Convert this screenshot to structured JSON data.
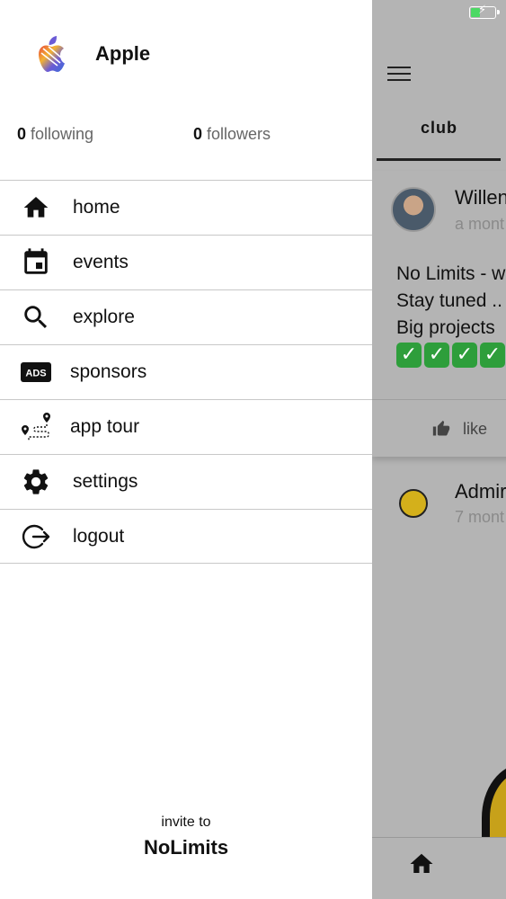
{
  "drawer": {
    "app_name": "Apple",
    "following_count": "0",
    "following_label": "following",
    "followers_count": "0",
    "followers_label": "followers",
    "menu": [
      {
        "label": "home",
        "icon": "home-icon"
      },
      {
        "label": "events",
        "icon": "calendar-icon"
      },
      {
        "label": "explore",
        "icon": "search-icon"
      },
      {
        "label": "sponsors",
        "icon": "ads-icon"
      },
      {
        "label": "app tour",
        "icon": "route-icon"
      },
      {
        "label": "settings",
        "icon": "gear-icon"
      },
      {
        "label": "logout",
        "icon": "logout-icon"
      }
    ],
    "ads_badge": "ADS",
    "invite_label": "invite to",
    "invite_brand": "NoLimits"
  },
  "background": {
    "tab_label": "club",
    "post1": {
      "author": "Willen",
      "time": "a mont",
      "lines": [
        "No Limits - w",
        "Stay tuned ..",
        "Big projects"
      ],
      "check_count": 4,
      "like_label": "like"
    },
    "post2": {
      "author": "Admir",
      "time": "7 mont"
    }
  },
  "colors": {
    "drawer_bg": "#ffffff",
    "overlay_bg": "#b4b4b4",
    "divider": "#c8c8c8",
    "check_green": "#2e9e3b",
    "battery_green": "#4cd964"
  }
}
